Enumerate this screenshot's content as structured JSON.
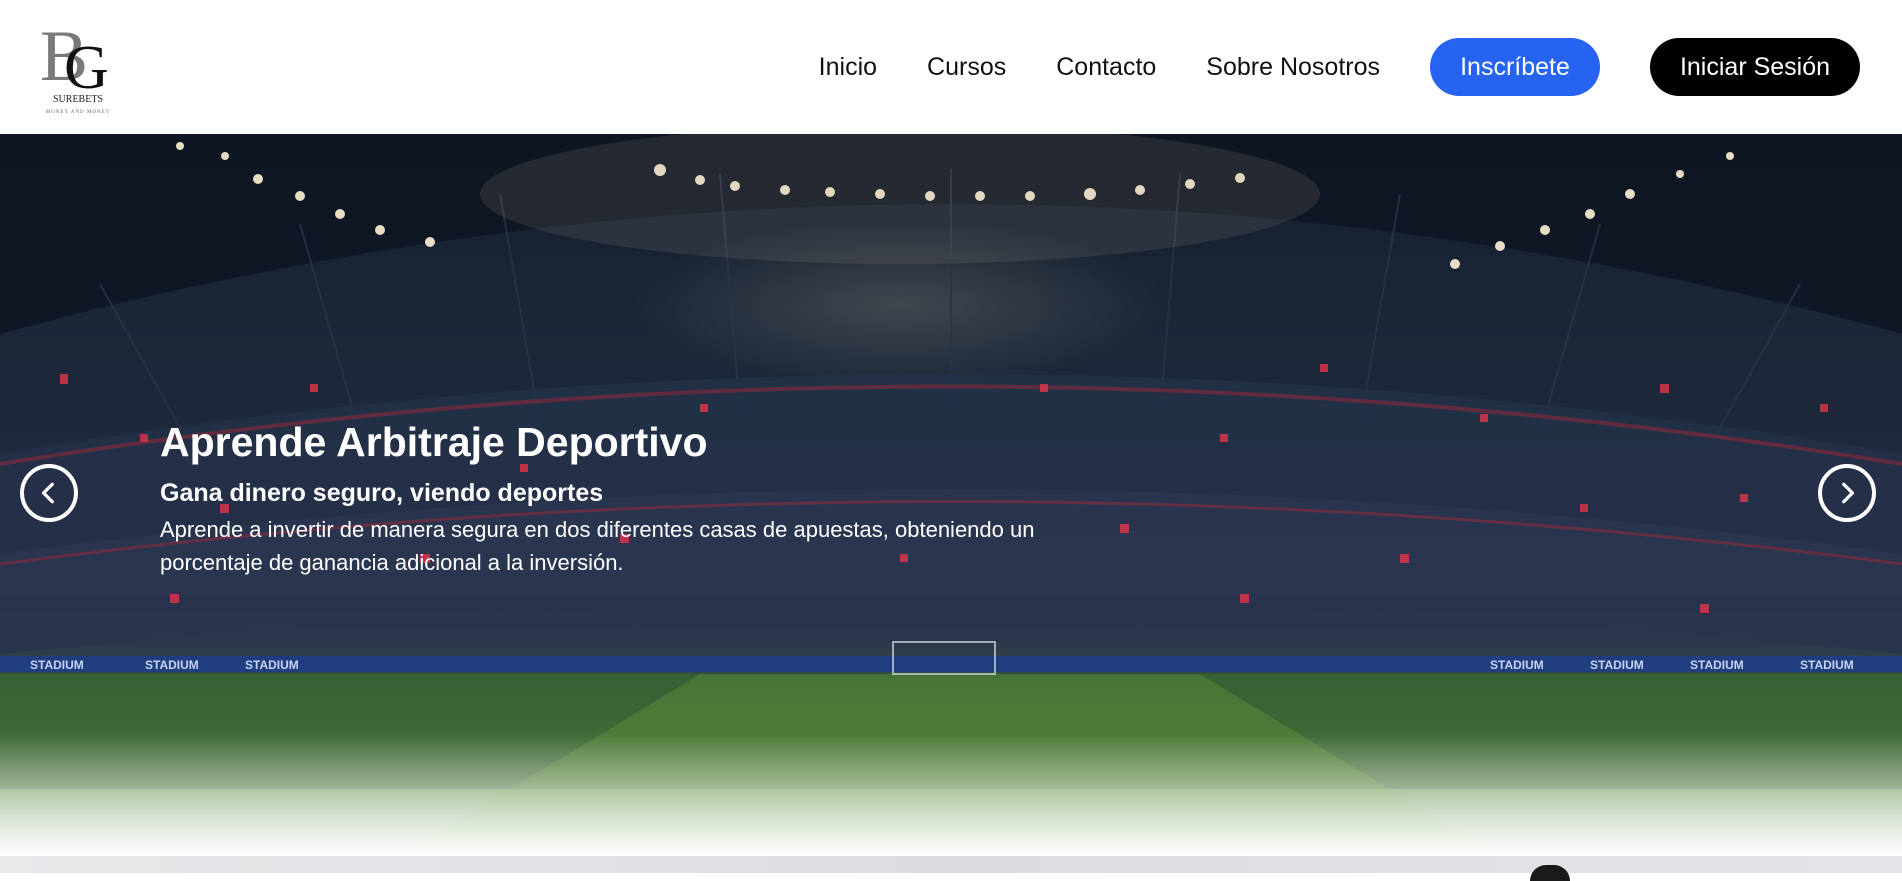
{
  "brand": {
    "initials": "BG",
    "name": "SUREBETS",
    "tagline": "MONEY AND MONEY"
  },
  "nav": {
    "links": [
      "Inicio",
      "Cursos",
      "Contacto",
      "Sobre Nosotros"
    ],
    "signup_label": "Inscríbete",
    "login_label": "Iniciar Sesión"
  },
  "hero": {
    "title": "Aprende Arbitraje Deportivo",
    "subtitle": "Gana dinero seguro, viendo deportes",
    "description": "Aprende a invertir de manera segura en dos diferentes casas de apuestas, obteniendo un porcentaje de ganancia adicional a la inversión.",
    "banner_text": "STADIUM",
    "prev_icon": "chevron-left-icon",
    "next_icon": "chevron-right-icon"
  },
  "colors": {
    "primary": "#2563f0",
    "dark": "#000000",
    "text": "#111111"
  }
}
